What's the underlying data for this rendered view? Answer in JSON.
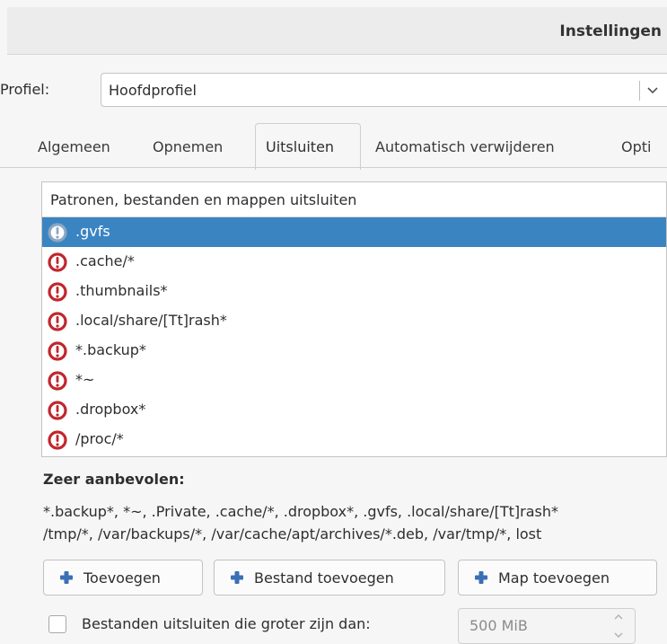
{
  "window": {
    "title": "Instellingen"
  },
  "profile": {
    "label": "Profiel:",
    "value": "Hoofdprofiel"
  },
  "tabs": {
    "general": "Algemeen",
    "capture": "Opnemen",
    "exclude": "Uitsluiten",
    "auto_delete": "Automatisch verwijderen",
    "options": "Opti"
  },
  "exclude_list": {
    "header": "Patronen, bestanden en mappen uitsluiten",
    "items": [
      ".gvfs",
      ".cache/*",
      ".thumbnails*",
      ".local/share/[Tt]rash*",
      "*.backup*",
      "*~",
      ".dropbox*",
      "/proc/*"
    ],
    "selected_index": 0
  },
  "recommended": {
    "title": "Zeer aanbevolen:",
    "lines": [
      "*.backup*, *~, .Private, .cache/*, .dropbox*, .gvfs, .local/share/[Tt]rash*",
      "/tmp/*, /var/backups/*, /var/cache/apt/archives/*.deb, /var/tmp/*, lost"
    ]
  },
  "buttons": {
    "add": "Toevoegen",
    "add_file": "Bestand toevoegen",
    "add_folder": "Map toevoegen"
  },
  "size_limit": {
    "label": "Bestanden uitsluiten die groter zijn dan:",
    "value": "500 MiB",
    "checked": false
  },
  "colors": {
    "selection": "#3b84c2",
    "warning_icon": "#c0272d",
    "plus_icon": "#3b6fb5"
  }
}
